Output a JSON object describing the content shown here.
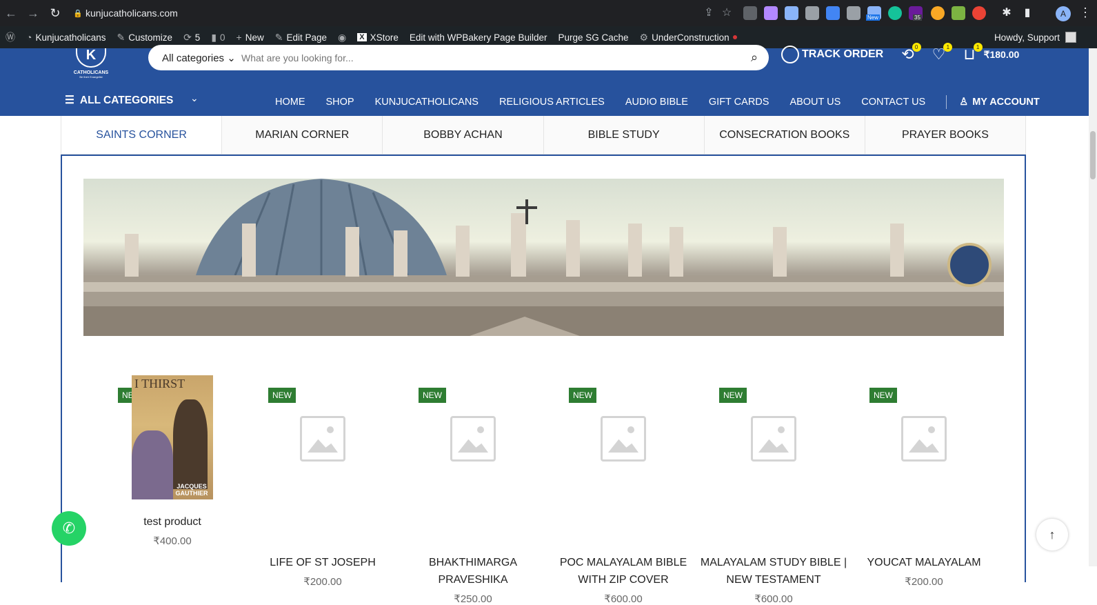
{
  "browser": {
    "url": "kunjucatholicans.com",
    "extensions": [
      "extension-icon",
      "extension-icon",
      "extension-icon",
      "extension-icon",
      "extension-icon",
      "extension-icon",
      "extension-icon",
      "extension-icon",
      "extension-icon",
      "extension-icon",
      "extension-icon",
      "extension-icon",
      "extension-icon",
      "extension-icon"
    ],
    "ext_badge_new": "New",
    "ext_badge_count": "35",
    "profile": "A"
  },
  "wpbar": {
    "site": "Kunjucatholicans",
    "customize": "Customize",
    "updates": "5",
    "comments": "0",
    "new": "New",
    "edit": "Edit Page",
    "xstore": "XStore",
    "wpbakery": "Edit with WPBakery Page Builder",
    "purge": "Purge SG Cache",
    "under": "UnderConstruction",
    "howdy": "Howdy, Support"
  },
  "header": {
    "logo_text": "CATHOLICANS",
    "logo_tagline": "Be their Evangelist",
    "logo_letter": "K",
    "category_select": "All categories",
    "search_placeholder": "What are you looking for...",
    "track": "TRACK ORDER",
    "compare_count": "0",
    "wishlist_count": "1",
    "cart_count": "1",
    "cart_total": "₹180.00"
  },
  "nav": {
    "all_categories": "ALL CATEGORIES",
    "items": [
      "HOME",
      "SHOP",
      "KUNJUCATHOLICANS",
      "RELIGIOUS ARTICLES",
      "AUDIO BIBLE",
      "GIFT CARDS",
      "ABOUT US",
      "CONTACT US"
    ],
    "account": "MY ACCOUNT"
  },
  "tabs": [
    "SAINTS CORNER",
    "MARIAN CORNER",
    "BOBBY ACHAN",
    "BIBLE STUDY",
    "CONSECRATION BOOKS",
    "PRAYER BOOKS"
  ],
  "products": [
    {
      "badge": "NEW",
      "name": "test product",
      "price": "₹400.00",
      "cover_title": "I THIRST",
      "cover_author": "JACQUES GAUTHIER"
    },
    {
      "badge": "NEW",
      "name": "LIFE OF ST JOSEPH",
      "price": "₹200.00"
    },
    {
      "badge": "NEW",
      "name": "BHAKTHIMARGA PRAVESHIKA",
      "price": "₹250.00"
    },
    {
      "badge": "NEW",
      "name": "POC MALAYALAM BIBLE WITH ZIP COVER",
      "price": "₹600.00"
    },
    {
      "badge": "NEW",
      "name": "MALAYALAM STUDY BIBLE | NEW TESTAMENT",
      "price": "₹600.00"
    },
    {
      "badge": "NEW",
      "name": "YOUCAT MALAYALAM",
      "price": "₹200.00"
    }
  ],
  "colors": {
    "brand": "#27529d",
    "badge": "#2e7d32",
    "whatsapp": "#25d366",
    "counter": "#fde800"
  }
}
